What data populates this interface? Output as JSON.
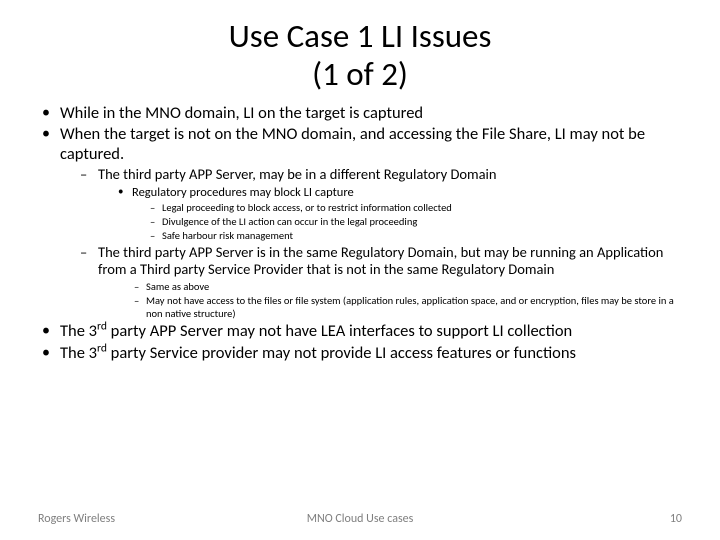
{
  "title_line1": "Use Case 1 LI Issues",
  "title_line2": "(1 of 2)",
  "bullets": {
    "b1": "While in the MNO domain, LI on the target is captured",
    "b2": "When the target is not on the MNO domain, and accessing the File  Share, LI may not be captured.",
    "b2_1": "The third party APP Server, may be in a different Regulatory Domain",
    "b2_1_1": "Regulatory procedures may block LI capture",
    "b2_1_1_1": "Legal proceeding to block access, or to restrict information collected",
    "b2_1_1_2": "Divulgence of the LI action can occur in the legal proceeding",
    "b2_1_1_3": "Safe harbour risk management",
    "b2_2": "The third party APP Server is in the same Regulatory Domain, but may be running an Application from a Third party Service Provider that is not in the same Regulatory Domain",
    "b2_2_1": "Same as above",
    "b2_2_2": "May not have access to the files or file system (application rules, application space, and or encryption, files may be store in a non native structure)",
    "b3_pre": "The 3",
    "b3_ord": "rd",
    "b3_post": "  party APP Server may not have LEA interfaces to support LI collection",
    "b4_pre": "The 3",
    "b4_ord": "rd",
    "b4_post": " party Service provider may not provide LI access features or functions"
  },
  "footer": {
    "left": "Rogers Wireless",
    "center": "MNO Cloud Use cases",
    "right": "10"
  }
}
